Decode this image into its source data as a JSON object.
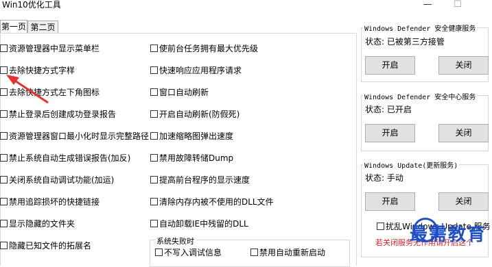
{
  "window": {
    "title": "Win10优化工具",
    "minimize": "—",
    "maximize": "☐"
  },
  "tabs": [
    {
      "label": "第一页",
      "active": true
    },
    {
      "label": "第二页",
      "active": false
    }
  ],
  "left_checks": [
    "资源管理器中显示菜单栏",
    "去除快捷方式字样",
    "去除快捷方式左下角图标",
    "禁止登录后创建成功登录报告",
    "资源管理器窗口最小化时显示完整路径",
    "禁止系统自动生成错误报告(加反)",
    "关闭系统自动调试功能(加运)",
    "禁用追踪损坏的快捷链接",
    "显示隐藏的文件夹",
    "隐藏已知文件的拓展名"
  ],
  "mid_checks": [
    "使前台任务拥有最大优先级",
    "快速响应应用程序请求",
    "窗口自动刷新",
    "开启自动刷新(防假死)",
    "加速缩略图弹出速度",
    "禁用故障转储Dump",
    "提高前台程序的显示速度",
    "清除内存内被不使用的DLL文件",
    "自动卸载IE中残留的DLL"
  ],
  "failure_group": {
    "label": "系统失败时",
    "items": [
      "不写入调试信息",
      "禁用自动重新启动"
    ]
  },
  "defender_health": {
    "label": "Windows Defender 安全健康服务",
    "status": "状态: 已被第三方接管",
    "on": "开启",
    "off": "关闭"
  },
  "defender_center": {
    "label": "Windows Defender 安全中心服务",
    "status": "状态: 已开启",
    "on": "开启",
    "off": "关闭"
  },
  "windows_update": {
    "label": "Windows Update(更新服务)",
    "status": "状态: 手动",
    "on": "开启",
    "off": "关闭",
    "checkbox": "扰乱Windows Update 服务",
    "note": "若关闭服务无作用请开启这个"
  },
  "watermark": "最需教育",
  "colors": {
    "note_red": "#e02020",
    "arrow_red": "#e53030",
    "watermark_blue": "#1e4fc8"
  }
}
